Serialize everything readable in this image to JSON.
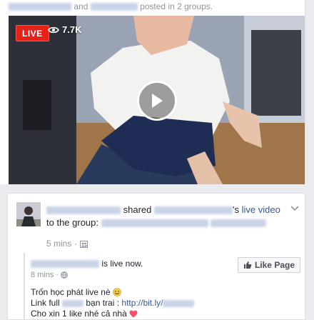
{
  "top_post": {
    "and_word": "and",
    "posted_text": "posted in 2 groups.",
    "video": {
      "live_label": "LIVE",
      "viewer_count": "7.7K",
      "play_icon": "play-icon",
      "eye_icon": "eye-icon"
    }
  },
  "shared_post": {
    "shared_word": "shared",
    "possessive": "'s",
    "live_video_link": "live video",
    "to_group_text": "to the group:",
    "time": "5 mins",
    "privacy_icon": "group-privacy-icon",
    "page_post": {
      "status": "is live now.",
      "time": "8 mins",
      "like_page_label": "Like Page",
      "message_line1": "Trốn học phát live nè",
      "message_line2_prefix": "Link full",
      "message_line2_middle": "bạn trai :",
      "message_line2_link": "http://bit.ly/",
      "message_line3": "Cho xin 1 like nhé cả nhà"
    }
  },
  "colors": {
    "live_red": "#e62117",
    "link_blue": "#365899",
    "meta_gray": "#90949c",
    "text_dark": "#1d2129"
  }
}
